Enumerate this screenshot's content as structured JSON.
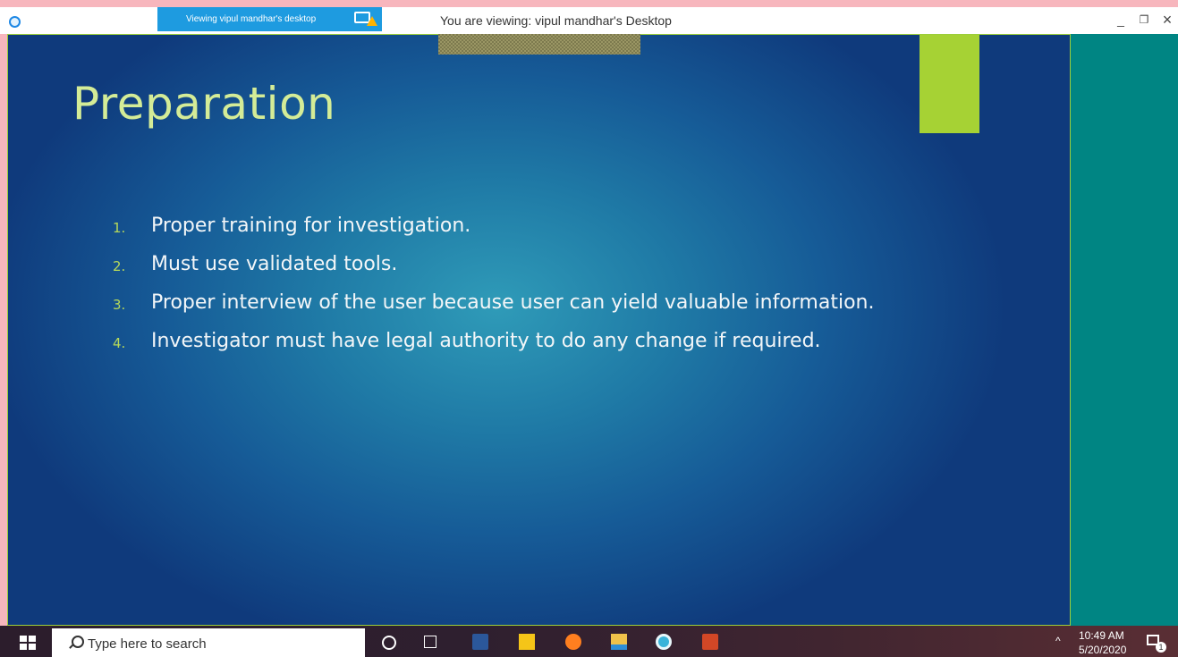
{
  "viewer": {
    "badge_text": "Viewing vipul mandhar's desktop",
    "window_title": "You are viewing: vipul mandhar's Desktop",
    "controls": {
      "minimize": "_",
      "restore": "❐",
      "close": "×"
    }
  },
  "slide": {
    "title": "Preparation",
    "items": [
      {
        "num": "1.",
        "text": "Proper training for investigation."
      },
      {
        "num": "2.",
        "text": "Must use validated tools."
      },
      {
        "num": "3.",
        "text": "Proper interview of the user because user can yield valuable information."
      },
      {
        "num": "4.",
        "text": "Investigator must have legal authority to do any change if required."
      }
    ],
    "accent_color": "#a6d234"
  },
  "taskbar": {
    "search_placeholder": "Type here to search",
    "apps": [
      "cortana-icon",
      "task-view-icon",
      "word-icon",
      "sticky-notes-icon",
      "firefox-icon",
      "file-explorer-icon",
      "browser-icon",
      "powerpoint-icon"
    ],
    "tray": {
      "time": "10:49 AM",
      "date": "5/20/2020",
      "notification_count": "1"
    }
  }
}
